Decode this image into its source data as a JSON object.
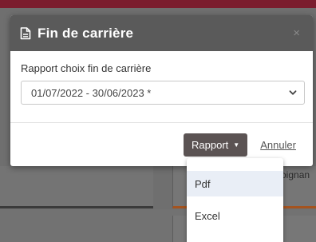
{
  "modal": {
    "title": "Fin de carrière",
    "title_icon": "document-icon",
    "close_glyph": "×",
    "field_label": "Rapport choix fin de carrière",
    "select_value": "01/07/2022 - 30/06/2023 *",
    "rapport_label": "Rapport",
    "annuler_label": "Annuler"
  },
  "dropdown": {
    "items": [
      {
        "label": "Pdf"
      },
      {
        "label": "Excel"
      }
    ]
  },
  "background": {
    "partial_text": "oignan"
  },
  "colors": {
    "header_bg": "#5a5a5a",
    "button_bg": "#5b5353",
    "highlight_item": "#e9eef6"
  }
}
